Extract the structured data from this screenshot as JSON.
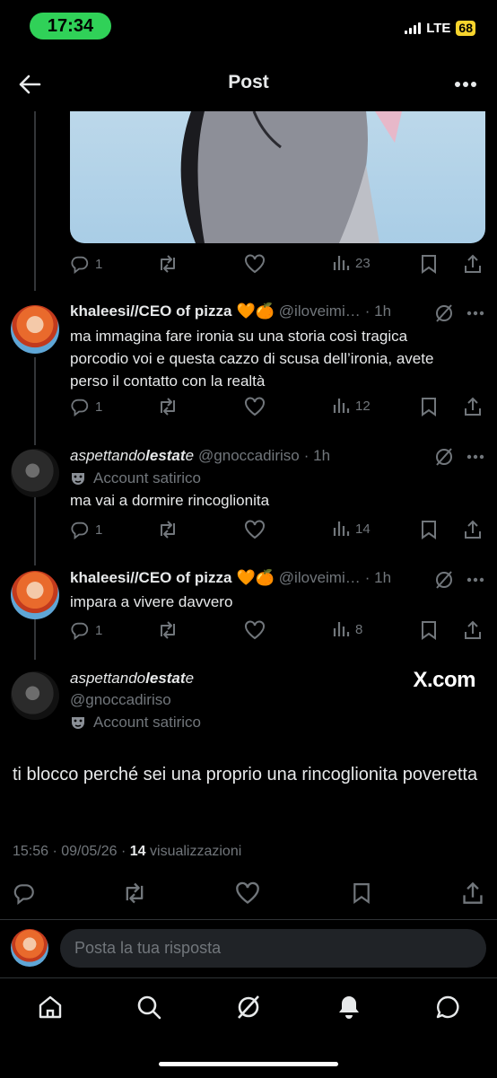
{
  "status_bar": {
    "time": "17:34",
    "network": "LTE",
    "battery": "68"
  },
  "header": {
    "back_icon": "arrow-left-icon",
    "title": "Post",
    "more_icon": "more-icon"
  },
  "colors": {
    "background": "#000000",
    "text": "#e7e9ea",
    "muted": "#71767b",
    "time_pill": "#30d158",
    "battery": "#f7d42d"
  },
  "tweets": [
    {
      "actions": {
        "replies": "1",
        "views": "23"
      }
    },
    {
      "name": "khaleesi//CEO of pizza",
      "emojis": "🧡🍊",
      "handle": "@iloveimi…",
      "time": "· 1h",
      "text": "ma immagina fare ironia su una storia così tragica porcodio voi e questa cazzo di scusa dell’ironia, avete perso il contatto con la realtà",
      "actions": {
        "replies": "1",
        "views": "12"
      }
    },
    {
      "name_plain": "aspettando",
      "name_bold": "lestat",
      "name_tail": "e",
      "handle": "@gnoccadiriso",
      "time": "· 1h",
      "badge": "Account satirico",
      "text": "ma vai a dormire rincoglionita",
      "actions": {
        "replies": "1",
        "views": "14"
      }
    },
    {
      "name": "khaleesi//CEO of pizza",
      "emojis": "🧡🍊",
      "handle": "@iloveimi…",
      "time": "· 1h",
      "text": "impara a vivere davvero",
      "actions": {
        "replies": "1",
        "views": "8"
      }
    }
  ],
  "main_post": {
    "name_plain": "aspettando",
    "name_bold": "lestat",
    "name_tail": "e",
    "handle": "@gnoccadiriso",
    "badge": "Account satirico",
    "watermark": "X.com",
    "text": "ti blocco perché sei una proprio una rincoglionita poveretta",
    "timestamp": "15:56 · 09/05/26 · ",
    "views_count": "14",
    "views_label": " visualizzazioni"
  },
  "reply": {
    "placeholder": "Posta la tua risposta"
  },
  "tabbar": [
    "home-icon",
    "search-icon",
    "grok-icon",
    "notifications-icon",
    "messages-icon"
  ]
}
